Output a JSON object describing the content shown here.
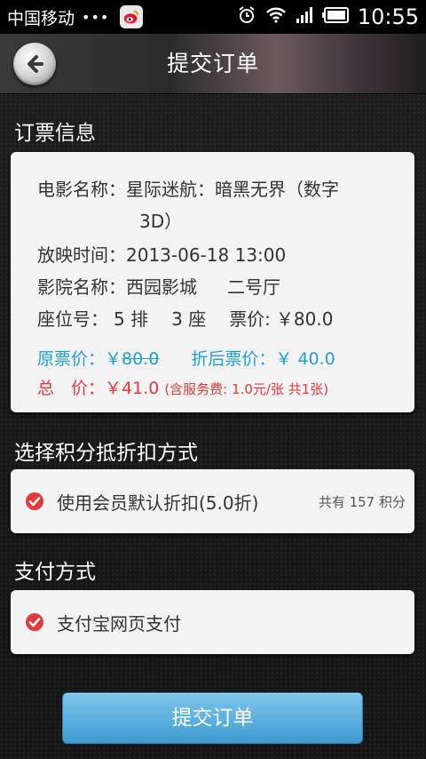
{
  "status_bar": {
    "carrier": "中国移动",
    "dots": "•••",
    "time": "10:55",
    "icons": [
      "weibo-icon",
      "alarm-icon",
      "wifi-icon",
      "signal-icon",
      "battery-icon"
    ]
  },
  "header": {
    "title": "提交订单",
    "back_icon": "back-arrow-icon"
  },
  "ticket_info": {
    "section_title": "订票信息",
    "movie_label": "电影名称：",
    "movie_name_line1": "星际迷航：暗黑无界（数字",
    "movie_name_line2": "3D）",
    "showtime_label": "放映时间：",
    "showtime": "2013-06-18 13:00",
    "cinema_label": "影院名称：",
    "cinema": "西园影城",
    "hall": "二号厅",
    "seat_label": "座位号：",
    "seat_row": "5 排",
    "seat_col": "3 座",
    "ticket_price_label": "票价:",
    "ticket_price": "￥80.0",
    "original_price_label": "原票价：",
    "original_price_currency": "￥",
    "original_price": "80.0",
    "discount_price_label": "折后票价：",
    "discount_price": "￥ 40.0",
    "total_label": "总　价：",
    "total": "￥41.0",
    "service_note": "(含服务费: 1.0元/张  共1张)"
  },
  "points": {
    "section_title": "选择积分抵折扣方式",
    "option_label": "使用会员默认折扣(5.0折)",
    "points_text": "共有 157 积分",
    "checked": true
  },
  "payment": {
    "section_title": "支付方式",
    "option_label": "支付宝网页支付",
    "checked": true
  },
  "submit_button": "提交订单",
  "colors": {
    "accent_blue": "#1e9fd8",
    "accent_red": "#e23b3b",
    "button_blue": "#4aa6d8"
  }
}
